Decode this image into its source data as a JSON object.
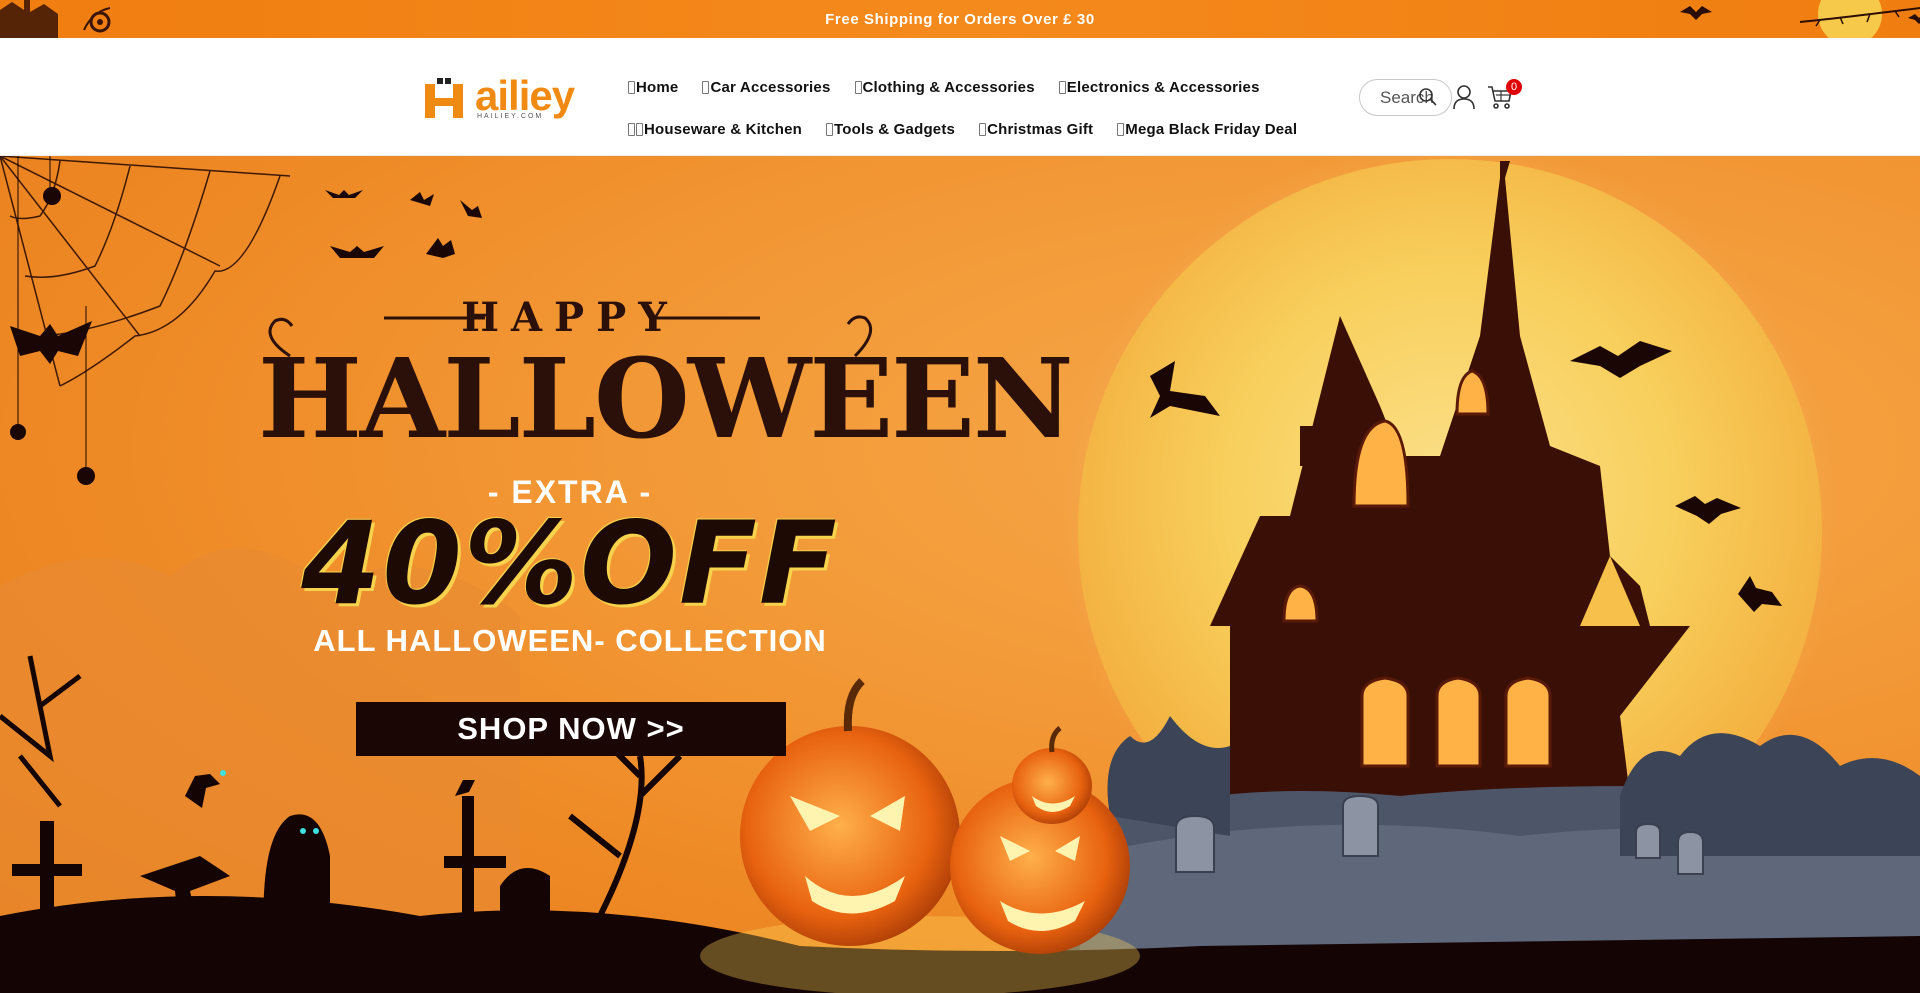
{
  "announcement": {
    "text": "Free Shipping for Orders Over £ 30"
  },
  "header": {
    "logo": {
      "wordmark": "ailiey",
      "subtext": "HAILIEY.COM"
    },
    "nav_rows": [
      [
        {
          "label": "Home"
        },
        {
          "label": "Car Accessories"
        },
        {
          "label": "Clothing & Accessories"
        },
        {
          "label": "Electronics & Accessories"
        }
      ],
      [
        {
          "label": "Houseware & Kitchen"
        },
        {
          "label": "Tools & Gadgets"
        },
        {
          "label": "Christmas Gift"
        },
        {
          "label": "Mega Black Friday Deal"
        }
      ]
    ],
    "search": {
      "placeholder": "Search"
    },
    "cart": {
      "count": "0"
    }
  },
  "hero": {
    "happy": "HAPPY",
    "title": "HALLOWEEN",
    "extra": "- EXTRA -",
    "discount": "40%OFF",
    "collection": "ALL HALLOWEEN- COLLECTION",
    "cta": "SHOP NOW >>"
  },
  "colors": {
    "brand_orange": "#f08a12",
    "announce_bg": "#f58a1c",
    "cta_bg": "#1a0605",
    "cart_badge": "#e00000"
  },
  "icons": [
    "search-icon",
    "account-icon",
    "cart-icon"
  ]
}
